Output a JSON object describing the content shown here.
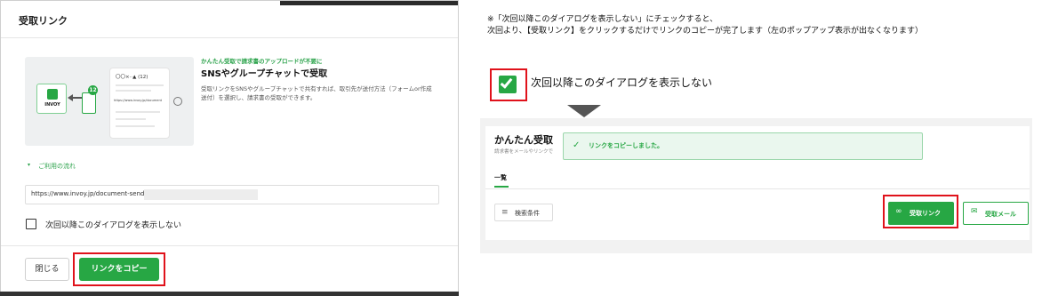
{
  "dialog": {
    "title": "受取リンク",
    "illustration": {
      "logo_text": "INVOY",
      "badge_count": "12",
      "card_header": "〇〇×··▲ (12)",
      "card_url": "https://www.invoy.jp/document"
    },
    "tagline": "かんたん受取で請求書のアップロードが不要に",
    "heading": "SNSやグループチャットで受取",
    "description": "受取リンクをSNSやグループチャットで共有すれば、取引先が送付方法（フォームor作成送付）を選択し、請求書の受取ができます。",
    "flow_label": "ご利用の流れ",
    "url_value": "https://www.invoy.jp/document-send/",
    "dont_show_label": "次回以降このダイアログを表示しない",
    "close_label": "閉じる",
    "copy_label": "リンクをコピー"
  },
  "note": {
    "line1": "※「次回以降このダイアログを表示しない」にチェックすると、",
    "line2": "次回より、【受取リンク】をクリックするだけでリンクのコピーが完了します（左のポップアップ表示が出なくなります）"
  },
  "demo_checkbox_label": "次回以降このダイアログを表示しない",
  "app": {
    "title": "かんたん受取",
    "subtitle": "請求書をメールやリンクで",
    "toast": "リンクをコピーしました。",
    "tab_label": "一覧",
    "filter_label": "検索条件",
    "receive_link_label": "受取リンク",
    "receive_mail_label": "受取メール"
  },
  "colors": {
    "accent_green": "#27a744",
    "highlight_red": "#e0121b"
  }
}
